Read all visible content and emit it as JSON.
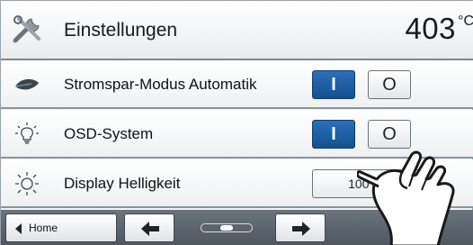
{
  "header": {
    "title": "Einstellungen",
    "temperature": "403",
    "temperature_unit": "°C",
    "icon": "tools-icon"
  },
  "rows": [
    {
      "label": "Stromspar-Modus Automatik",
      "icon": "leaf-icon",
      "on_label": "I",
      "off_label": "O"
    },
    {
      "label": "OSD-System",
      "icon": "bulb-icon",
      "on_label": "I",
      "off_label": "O"
    },
    {
      "label": "Display Helligkeit",
      "icon": "sun-icon",
      "value": "100 %"
    }
  ],
  "footer": {
    "home_label": "Home",
    "back_icon": "arrow-left-icon",
    "forward_icon": "arrow-right-icon",
    "scroll_icon": "scroll-indicator-icon"
  },
  "colors": {
    "accent_blue": "#1e5fa3",
    "footer_bg": "#5a636b"
  }
}
